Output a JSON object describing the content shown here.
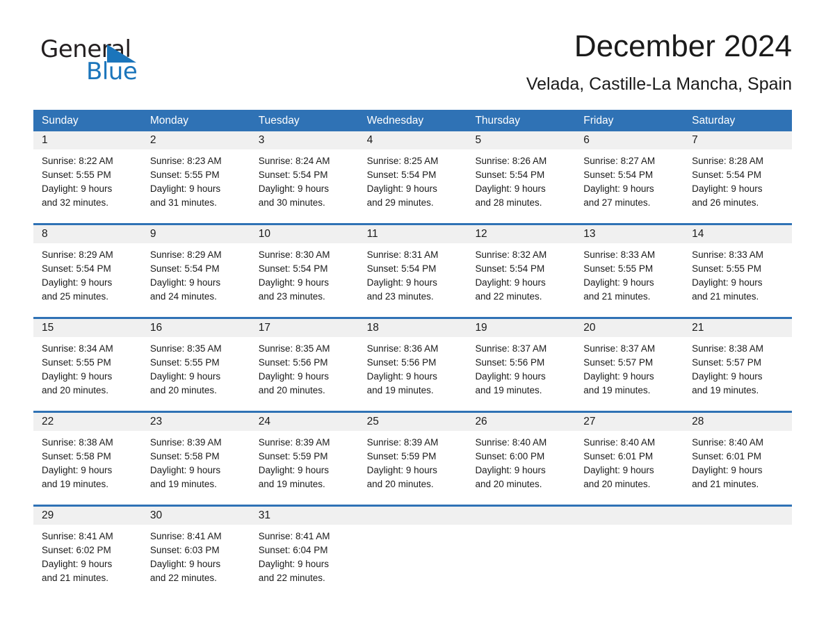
{
  "brand": {
    "word1": "General",
    "word2": "Blue",
    "triangle_color": "#1b75bb"
  },
  "header": {
    "month_title": "December 2024",
    "location": "Velada, Castille-La Mancha, Spain"
  },
  "theme": {
    "header_blue": "#2f72b5",
    "day_band_gray": "#f0f0f0",
    "text_color": "#1a1a1a"
  },
  "weekdays": [
    "Sunday",
    "Monday",
    "Tuesday",
    "Wednesday",
    "Thursday",
    "Friday",
    "Saturday"
  ],
  "weeks": [
    [
      {
        "day": "1",
        "sunrise": "Sunrise: 8:22 AM",
        "sunset": "Sunset: 5:55 PM",
        "daylight_line1": "Daylight: 9 hours",
        "daylight_line2": "and 32 minutes."
      },
      {
        "day": "2",
        "sunrise": "Sunrise: 8:23 AM",
        "sunset": "Sunset: 5:55 PM",
        "daylight_line1": "Daylight: 9 hours",
        "daylight_line2": "and 31 minutes."
      },
      {
        "day": "3",
        "sunrise": "Sunrise: 8:24 AM",
        "sunset": "Sunset: 5:54 PM",
        "daylight_line1": "Daylight: 9 hours",
        "daylight_line2": "and 30 minutes."
      },
      {
        "day": "4",
        "sunrise": "Sunrise: 8:25 AM",
        "sunset": "Sunset: 5:54 PM",
        "daylight_line1": "Daylight: 9 hours",
        "daylight_line2": "and 29 minutes."
      },
      {
        "day": "5",
        "sunrise": "Sunrise: 8:26 AM",
        "sunset": "Sunset: 5:54 PM",
        "daylight_line1": "Daylight: 9 hours",
        "daylight_line2": "and 28 minutes."
      },
      {
        "day": "6",
        "sunrise": "Sunrise: 8:27 AM",
        "sunset": "Sunset: 5:54 PM",
        "daylight_line1": "Daylight: 9 hours",
        "daylight_line2": "and 27 minutes."
      },
      {
        "day": "7",
        "sunrise": "Sunrise: 8:28 AM",
        "sunset": "Sunset: 5:54 PM",
        "daylight_line1": "Daylight: 9 hours",
        "daylight_line2": "and 26 minutes."
      }
    ],
    [
      {
        "day": "8",
        "sunrise": "Sunrise: 8:29 AM",
        "sunset": "Sunset: 5:54 PM",
        "daylight_line1": "Daylight: 9 hours",
        "daylight_line2": "and 25 minutes."
      },
      {
        "day": "9",
        "sunrise": "Sunrise: 8:29 AM",
        "sunset": "Sunset: 5:54 PM",
        "daylight_line1": "Daylight: 9 hours",
        "daylight_line2": "and 24 minutes."
      },
      {
        "day": "10",
        "sunrise": "Sunrise: 8:30 AM",
        "sunset": "Sunset: 5:54 PM",
        "daylight_line1": "Daylight: 9 hours",
        "daylight_line2": "and 23 minutes."
      },
      {
        "day": "11",
        "sunrise": "Sunrise: 8:31 AM",
        "sunset": "Sunset: 5:54 PM",
        "daylight_line1": "Daylight: 9 hours",
        "daylight_line2": "and 23 minutes."
      },
      {
        "day": "12",
        "sunrise": "Sunrise: 8:32 AM",
        "sunset": "Sunset: 5:54 PM",
        "daylight_line1": "Daylight: 9 hours",
        "daylight_line2": "and 22 minutes."
      },
      {
        "day": "13",
        "sunrise": "Sunrise: 8:33 AM",
        "sunset": "Sunset: 5:55 PM",
        "daylight_line1": "Daylight: 9 hours",
        "daylight_line2": "and 21 minutes."
      },
      {
        "day": "14",
        "sunrise": "Sunrise: 8:33 AM",
        "sunset": "Sunset: 5:55 PM",
        "daylight_line1": "Daylight: 9 hours",
        "daylight_line2": "and 21 minutes."
      }
    ],
    [
      {
        "day": "15",
        "sunrise": "Sunrise: 8:34 AM",
        "sunset": "Sunset: 5:55 PM",
        "daylight_line1": "Daylight: 9 hours",
        "daylight_line2": "and 20 minutes."
      },
      {
        "day": "16",
        "sunrise": "Sunrise: 8:35 AM",
        "sunset": "Sunset: 5:55 PM",
        "daylight_line1": "Daylight: 9 hours",
        "daylight_line2": "and 20 minutes."
      },
      {
        "day": "17",
        "sunrise": "Sunrise: 8:35 AM",
        "sunset": "Sunset: 5:56 PM",
        "daylight_line1": "Daylight: 9 hours",
        "daylight_line2": "and 20 minutes."
      },
      {
        "day": "18",
        "sunrise": "Sunrise: 8:36 AM",
        "sunset": "Sunset: 5:56 PM",
        "daylight_line1": "Daylight: 9 hours",
        "daylight_line2": "and 19 minutes."
      },
      {
        "day": "19",
        "sunrise": "Sunrise: 8:37 AM",
        "sunset": "Sunset: 5:56 PM",
        "daylight_line1": "Daylight: 9 hours",
        "daylight_line2": "and 19 minutes."
      },
      {
        "day": "20",
        "sunrise": "Sunrise: 8:37 AM",
        "sunset": "Sunset: 5:57 PM",
        "daylight_line1": "Daylight: 9 hours",
        "daylight_line2": "and 19 minutes."
      },
      {
        "day": "21",
        "sunrise": "Sunrise: 8:38 AM",
        "sunset": "Sunset: 5:57 PM",
        "daylight_line1": "Daylight: 9 hours",
        "daylight_line2": "and 19 minutes."
      }
    ],
    [
      {
        "day": "22",
        "sunrise": "Sunrise: 8:38 AM",
        "sunset": "Sunset: 5:58 PM",
        "daylight_line1": "Daylight: 9 hours",
        "daylight_line2": "and 19 minutes."
      },
      {
        "day": "23",
        "sunrise": "Sunrise: 8:39 AM",
        "sunset": "Sunset: 5:58 PM",
        "daylight_line1": "Daylight: 9 hours",
        "daylight_line2": "and 19 minutes."
      },
      {
        "day": "24",
        "sunrise": "Sunrise: 8:39 AM",
        "sunset": "Sunset: 5:59 PM",
        "daylight_line1": "Daylight: 9 hours",
        "daylight_line2": "and 19 minutes."
      },
      {
        "day": "25",
        "sunrise": "Sunrise: 8:39 AM",
        "sunset": "Sunset: 5:59 PM",
        "daylight_line1": "Daylight: 9 hours",
        "daylight_line2": "and 20 minutes."
      },
      {
        "day": "26",
        "sunrise": "Sunrise: 8:40 AM",
        "sunset": "Sunset: 6:00 PM",
        "daylight_line1": "Daylight: 9 hours",
        "daylight_line2": "and 20 minutes."
      },
      {
        "day": "27",
        "sunrise": "Sunrise: 8:40 AM",
        "sunset": "Sunset: 6:01 PM",
        "daylight_line1": "Daylight: 9 hours",
        "daylight_line2": "and 20 minutes."
      },
      {
        "day": "28",
        "sunrise": "Sunrise: 8:40 AM",
        "sunset": "Sunset: 6:01 PM",
        "daylight_line1": "Daylight: 9 hours",
        "daylight_line2": "and 21 minutes."
      }
    ],
    [
      {
        "day": "29",
        "sunrise": "Sunrise: 8:41 AM",
        "sunset": "Sunset: 6:02 PM",
        "daylight_line1": "Daylight: 9 hours",
        "daylight_line2": "and 21 minutes."
      },
      {
        "day": "30",
        "sunrise": "Sunrise: 8:41 AM",
        "sunset": "Sunset: 6:03 PM",
        "daylight_line1": "Daylight: 9 hours",
        "daylight_line2": "and 22 minutes."
      },
      {
        "day": "31",
        "sunrise": "Sunrise: 8:41 AM",
        "sunset": "Sunset: 6:04 PM",
        "daylight_line1": "Daylight: 9 hours",
        "daylight_line2": "and 22 minutes."
      },
      {
        "day": "",
        "sunrise": "",
        "sunset": "",
        "daylight_line1": "",
        "daylight_line2": ""
      },
      {
        "day": "",
        "sunrise": "",
        "sunset": "",
        "daylight_line1": "",
        "daylight_line2": ""
      },
      {
        "day": "",
        "sunrise": "",
        "sunset": "",
        "daylight_line1": "",
        "daylight_line2": ""
      },
      {
        "day": "",
        "sunrise": "",
        "sunset": "",
        "daylight_line1": "",
        "daylight_line2": ""
      }
    ]
  ]
}
